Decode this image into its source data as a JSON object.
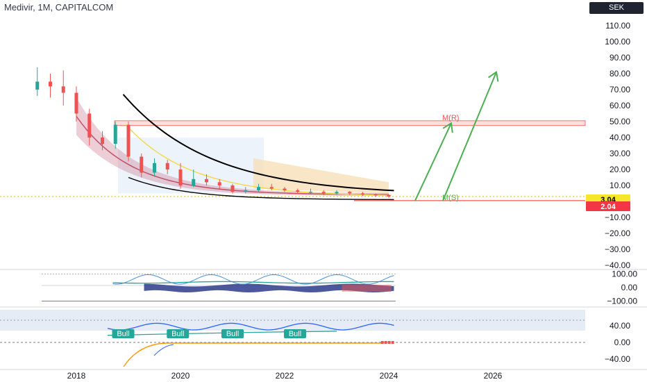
{
  "header": {
    "title": "Medivir, 1M, CAPITALCOM",
    "currency": "SEK"
  },
  "colors": {
    "bull": "#26a69a",
    "bear": "#ef5350",
    "axis_text": "#131722",
    "price_tag_current": "#f5e62a",
    "price_tag_low": "#f23645",
    "arrow": "#4caf50",
    "ma_black": "#000000",
    "ma_yellow": "#f2d84b",
    "band_red": "#c0506a",
    "resistance_zone": "#f4a6a6",
    "projection_zone": "#f5deb3",
    "osc_blue": "#2d3b8a",
    "rsi_blue": "#2962ff",
    "ema_orange": "#ff9800"
  },
  "chart_data": [
    {
      "type": "candlestick",
      "pane": "main",
      "x_ticks": [
        "2018",
        "2020",
        "2022",
        "2024",
        "2026"
      ],
      "y_ticks": [
        "110.00",
        "100.00",
        "90.00",
        "80.00",
        "70.00",
        "60.00",
        "50.00",
        "40.00",
        "30.00",
        "20.00",
        "10.00",
        "0.00",
        "−10.00",
        "−20.00",
        "−30.00",
        "−40.00"
      ],
      "ylim": [
        -40,
        120
      ],
      "price_tags": [
        {
          "label": "3.04",
          "value": 3.04,
          "color": "#f5e62a"
        },
        {
          "label": "2.04",
          "value": 2.04,
          "color": "#f23645"
        }
      ],
      "annotations": [
        {
          "text": "M(R)",
          "x": 2025.4,
          "y": 50
        },
        {
          "text": "M(S)",
          "x": 2025.4,
          "y": 0
        }
      ],
      "close_series": [
        {
          "t": 2017.25,
          "o": 70,
          "c": 75,
          "h": 84,
          "l": 66
        },
        {
          "t": 2017.5,
          "o": 75,
          "c": 72,
          "h": 80,
          "l": 65
        },
        {
          "t": 2017.75,
          "o": 72,
          "c": 68,
          "h": 82,
          "l": 60
        },
        {
          "t": 2018.0,
          "o": 68,
          "c": 55,
          "h": 72,
          "l": 50
        },
        {
          "t": 2018.25,
          "o": 55,
          "c": 40,
          "h": 58,
          "l": 35
        },
        {
          "t": 2018.5,
          "o": 40,
          "c": 36,
          "h": 44,
          "l": 32
        },
        {
          "t": 2018.75,
          "o": 36,
          "c": 48,
          "h": 50,
          "l": 33
        },
        {
          "t": 2019.0,
          "o": 48,
          "c": 28,
          "h": 50,
          "l": 25
        },
        {
          "t": 2019.25,
          "o": 28,
          "c": 18,
          "h": 30,
          "l": 15
        },
        {
          "t": 2019.5,
          "o": 18,
          "c": 24,
          "h": 27,
          "l": 16
        },
        {
          "t": 2019.75,
          "o": 24,
          "c": 20,
          "h": 26,
          "l": 17
        },
        {
          "t": 2020.0,
          "o": 20,
          "c": 10,
          "h": 24,
          "l": 8
        },
        {
          "t": 2020.25,
          "o": 10,
          "c": 14,
          "h": 20,
          "l": 9
        },
        {
          "t": 2020.5,
          "o": 14,
          "c": 12,
          "h": 17,
          "l": 10
        },
        {
          "t": 2020.75,
          "o": 12,
          "c": 10,
          "h": 14,
          "l": 8
        },
        {
          "t": 2021.0,
          "o": 10,
          "c": 6,
          "h": 11,
          "l": 5
        },
        {
          "t": 2021.25,
          "o": 6,
          "c": 7,
          "h": 9,
          "l": 5
        },
        {
          "t": 2021.5,
          "o": 7,
          "c": 9,
          "h": 11,
          "l": 6
        },
        {
          "t": 2021.75,
          "o": 9,
          "c": 8,
          "h": 11,
          "l": 7
        },
        {
          "t": 2022.0,
          "o": 8,
          "c": 7,
          "h": 9,
          "l": 6
        },
        {
          "t": 2022.25,
          "o": 7,
          "c": 6,
          "h": 8,
          "l": 5
        },
        {
          "t": 2022.5,
          "o": 6,
          "c": 6,
          "h": 8,
          "l": 5
        },
        {
          "t": 2022.75,
          "o": 6,
          "c": 5,
          "h": 7,
          "l": 4
        },
        {
          "t": 2023.0,
          "o": 5,
          "c": 6,
          "h": 7,
          "l": 4
        },
        {
          "t": 2023.25,
          "o": 6,
          "c": 5,
          "h": 6.5,
          "l": 4
        },
        {
          "t": 2023.5,
          "o": 5,
          "c": 4.5,
          "h": 6,
          "l": 3.5
        },
        {
          "t": 2023.75,
          "o": 4.5,
          "c": 4,
          "h": 5,
          "l": 3
        },
        {
          "t": 2024.0,
          "o": 4,
          "c": 3.04,
          "h": 4.5,
          "l": 2.04
        }
      ]
    },
    {
      "type": "line",
      "pane": "oscillator",
      "y_ticks": [
        "100.00",
        "0.00",
        "−100.00"
      ],
      "ylim": [
        -120,
        120
      ]
    },
    {
      "type": "line",
      "pane": "rsi",
      "y_ticks": [
        "40.00",
        "0.00",
        "−40.00"
      ],
      "ylim": [
        -55,
        80
      ],
      "labels": [
        "Bull",
        "Bull",
        "Bull",
        "Bull"
      ]
    }
  ]
}
